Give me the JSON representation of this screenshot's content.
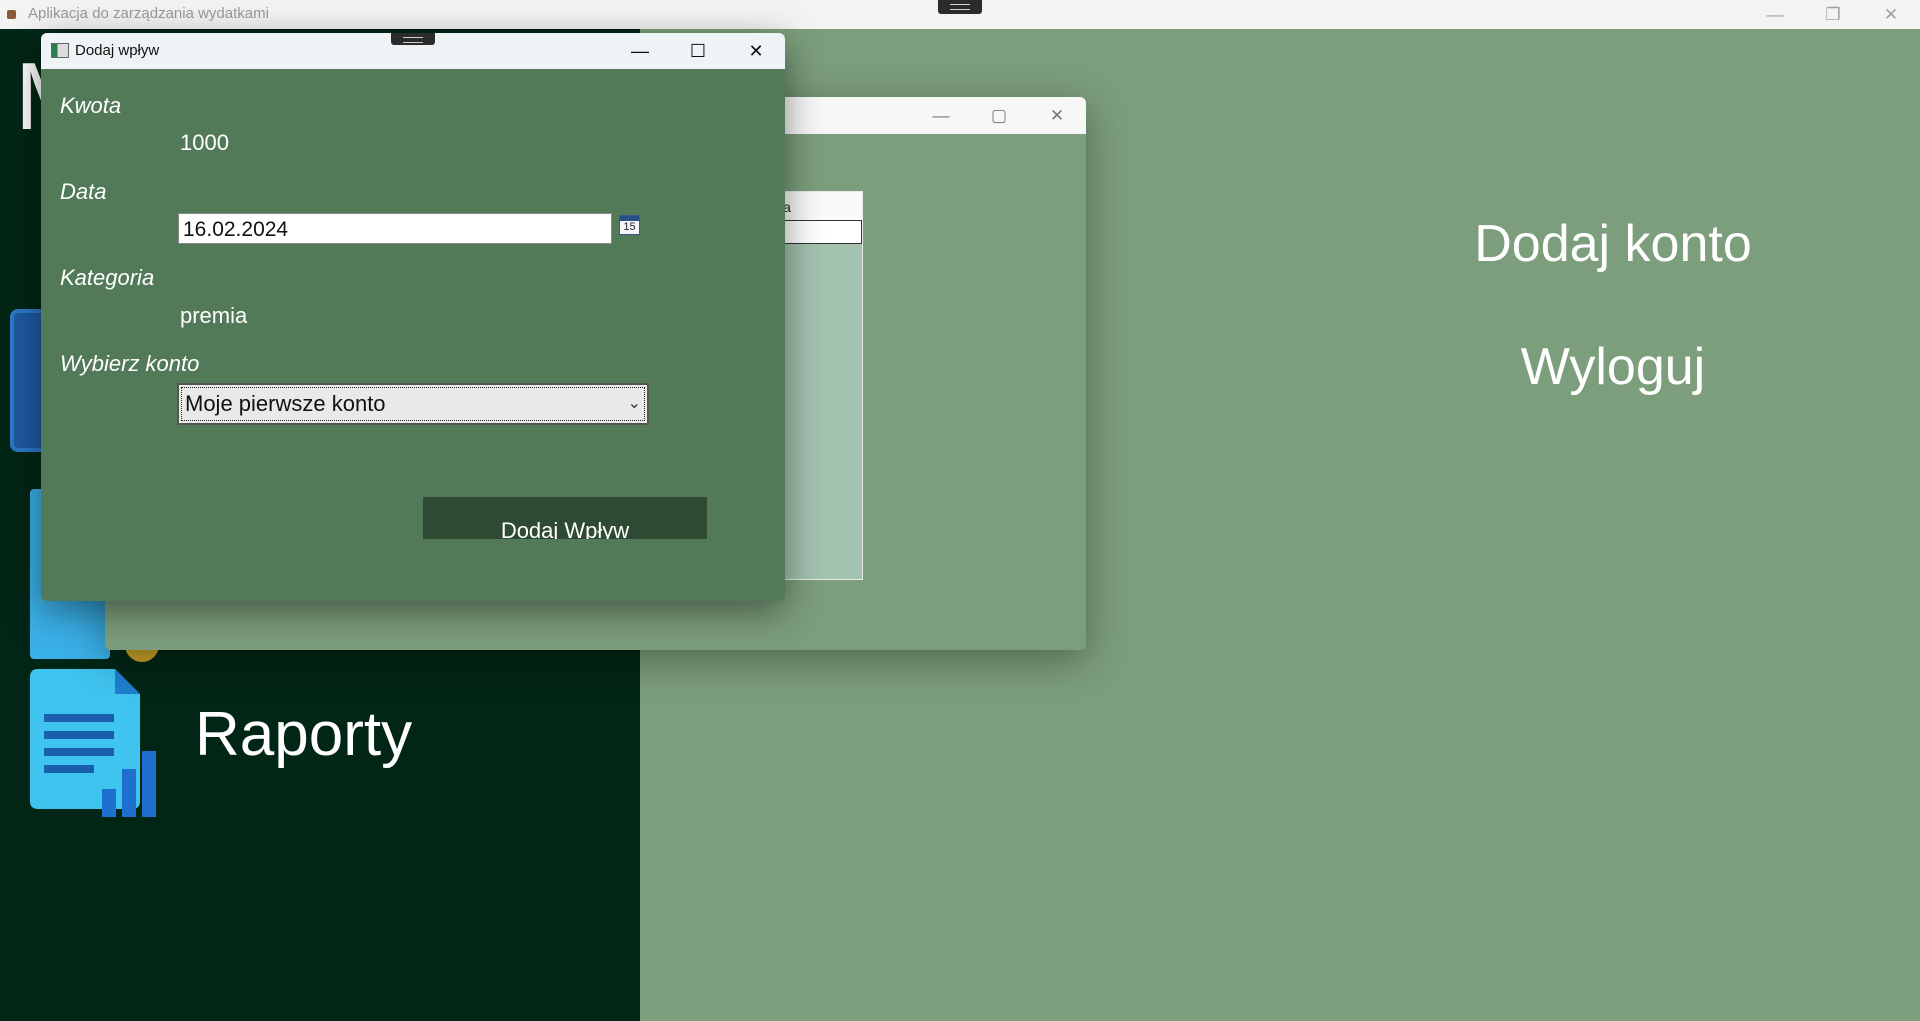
{
  "app": {
    "title": "Aplikacja do zarządzania wydatkami"
  },
  "window_controls": {
    "minimize": "—",
    "maximize": "▢",
    "close": "✕"
  },
  "sidebar": {
    "partial_heading_char": "M",
    "reports_label": "Raporty"
  },
  "right_panel": {
    "add_account": "Dodaj konto",
    "logout": "Wyloguj"
  },
  "mid_window": {
    "grid": {
      "columns": [
        "Kwota"
      ]
    }
  },
  "dialog": {
    "title": "Dodaj wpływ",
    "amount_label": "Kwota",
    "amount_value": "1000",
    "date_label": "Data",
    "date_value": "16.02.2024",
    "calendar_day": "15",
    "category_label": "Kategoria",
    "category_value": "premia",
    "account_label": "Wybierz konto",
    "account_selected": "Moje pierwsze konto",
    "submit": "Dodaj Wpływ"
  },
  "colors": {
    "sidebar_bg": "#022616",
    "panel_bg": "#7c9e7c",
    "dialog_bg": "#527a58",
    "button_bg": "#2e4a33"
  }
}
